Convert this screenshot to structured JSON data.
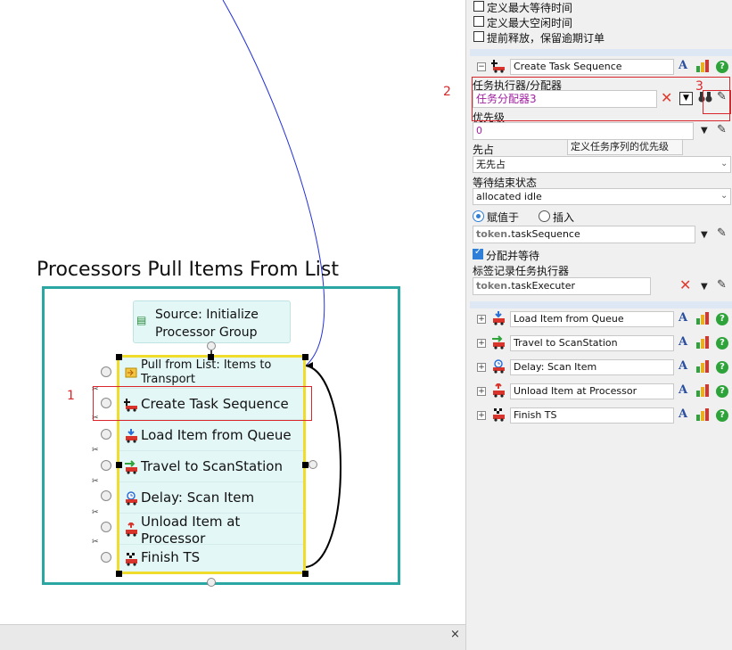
{
  "canvas": {
    "title": "Processors Pull Items From List",
    "source_label": "Source: Initialize Processor Group",
    "items": [
      {
        "label": "Pull from List: Items to Transport"
      },
      {
        "label": "Create Task Sequence"
      },
      {
        "label": "Load Item from Queue"
      },
      {
        "label": "Travel to ScanStation"
      },
      {
        "label": "Delay: Scan Item"
      },
      {
        "label": "Unload Item at Processor"
      },
      {
        "label": "Finish TS"
      }
    ],
    "annotations": [
      "1",
      "2",
      "3"
    ],
    "close_label": "×"
  },
  "panel": {
    "checkboxes": [
      {
        "label": "定义最大等待时间",
        "checked": false
      },
      {
        "label": "定义最大空闲时间",
        "checked": false
      },
      {
        "label": "提前释放，保留逾期订单",
        "checked": false
      }
    ],
    "expanded": {
      "name": "Create Task Sequence",
      "executor_label": "任务执行器/分配器",
      "executor_value": "任务分配器3",
      "priority_label": "优先级",
      "priority_value": "0",
      "tooltip": "定义任务序列的优先级",
      "preempt_label": "先占",
      "preempt_value": "无先占",
      "wait_label": "等待结束状态",
      "wait_value": "allocated idle",
      "assign_label": "赋值于",
      "insert_label": "插入",
      "assign_token": "token.",
      "assign_value": "taskSequence",
      "alloc_wait_label": "分配并等待",
      "record_label": "标签记录任务执行器",
      "record_token": "token.",
      "record_value": "taskExecuter"
    },
    "activities": [
      {
        "label": "Load Item from Queue"
      },
      {
        "label": "Travel to ScanStation"
      },
      {
        "label": "Delay: Scan Item"
      },
      {
        "label": "Unload Item at Processor"
      },
      {
        "label": "Finish TS"
      }
    ],
    "icon_A": "A",
    "help_label": "?"
  }
}
